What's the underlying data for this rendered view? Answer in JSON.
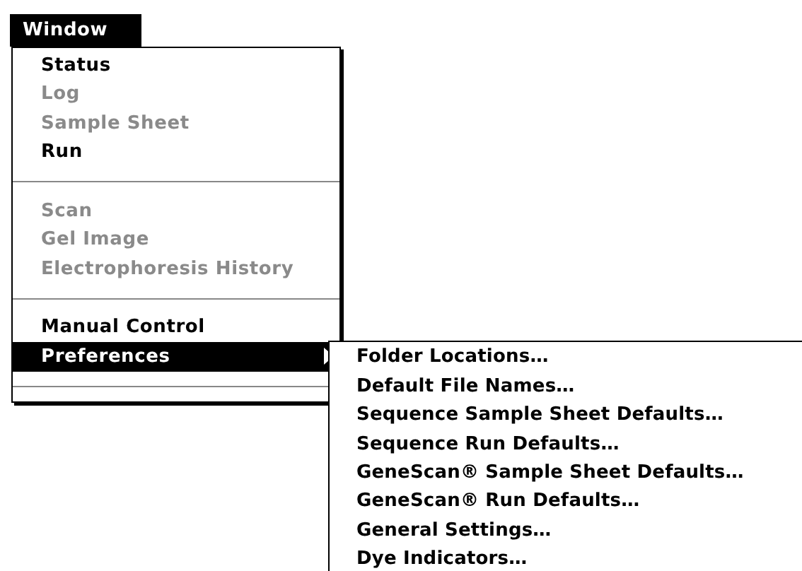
{
  "menu_bar": {
    "title": "Window",
    "selected": true
  },
  "menu": {
    "items": [
      {
        "kind": "item",
        "label": "Status",
        "disabled": false,
        "selected": false
      },
      {
        "kind": "item",
        "label": "Log",
        "disabled": true,
        "selected": false
      },
      {
        "kind": "item",
        "label": "Sample Sheet",
        "disabled": true,
        "selected": false
      },
      {
        "kind": "item",
        "label": "Run",
        "disabled": false,
        "selected": false
      },
      {
        "kind": "separator"
      },
      {
        "kind": "item",
        "label": "Scan",
        "disabled": true,
        "selected": false
      },
      {
        "kind": "item",
        "label": "Gel Image",
        "disabled": true,
        "selected": false
      },
      {
        "kind": "item",
        "label": "Electrophoresis History",
        "disabled": true,
        "selected": false
      },
      {
        "kind": "separator"
      },
      {
        "kind": "item",
        "label": "Manual Control",
        "disabled": false,
        "selected": false
      },
      {
        "kind": "submenu",
        "label": "Preferences",
        "disabled": false,
        "selected": true
      },
      {
        "kind": "separator"
      }
    ]
  },
  "submenu": {
    "items": [
      {
        "label": "Folder Locations…"
      },
      {
        "label": "Default File Names…"
      },
      {
        "label": "Sequence Sample Sheet Defaults…"
      },
      {
        "label": "Sequence Run Defaults…"
      },
      {
        "label": "GeneScan® Sample Sheet Defaults…"
      },
      {
        "label": "GeneScan® Run Defaults…"
      },
      {
        "label": "General Settings…"
      },
      {
        "label": "Dye Indicators…"
      }
    ]
  }
}
